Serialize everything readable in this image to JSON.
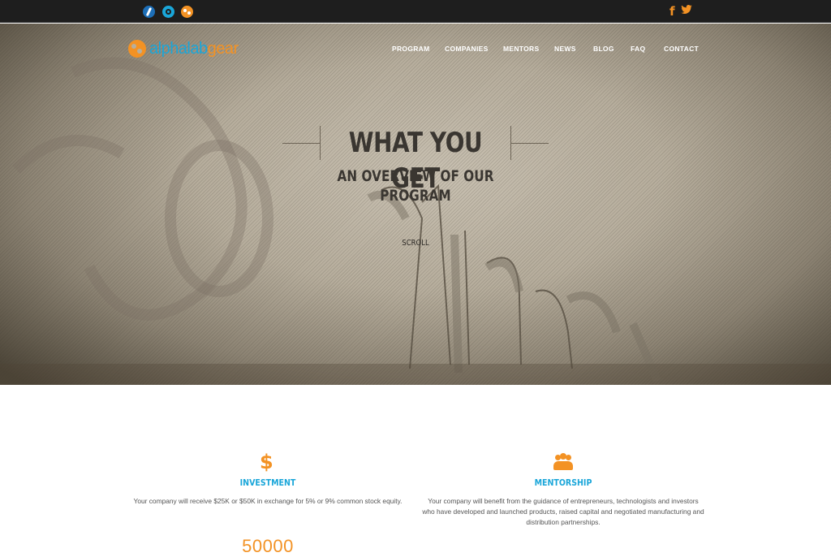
{
  "topbar": {
    "left_icons": [
      "behance-icon",
      "ello-icon",
      "alphalab-icon"
    ],
    "right_icons": [
      "facebook-icon",
      "twitter-icon"
    ],
    "facebook_glyph": "f",
    "twitter_glyph": "🐦"
  },
  "logo": {
    "part1": "alphalab",
    "part2": "gear"
  },
  "nav": {
    "items": [
      "PROGRAM",
      "COMPANIES",
      "MENTORS",
      "NEWS",
      "BLOG",
      "FAQ",
      "CONTACT"
    ]
  },
  "hero": {
    "title": "WHAT YOU GET",
    "subtitle": "AN OVERVIEW OF OUR PROGRAM",
    "scroll_label": "SCROLL"
  },
  "features": [
    {
      "icon": "dollar-icon",
      "icon_glyph": "$",
      "title": "INVESTMENT",
      "description": "Your company will receive $25K or $50K in exchange for 5% or 9% common stock equity."
    },
    {
      "icon": "team-icon",
      "title": "MENTORSHIP",
      "description": "Your company will benefit from the guidance of entrepreneurs, technologists and investors who have developed and launched products, raised capital and negotiated manufacturing and distribution partnerships."
    }
  ],
  "counter": {
    "value": "50000"
  },
  "colors": {
    "accent_orange": "#f39224",
    "accent_blue": "#1aa6d9",
    "topbar": "#1e1e1e"
  }
}
